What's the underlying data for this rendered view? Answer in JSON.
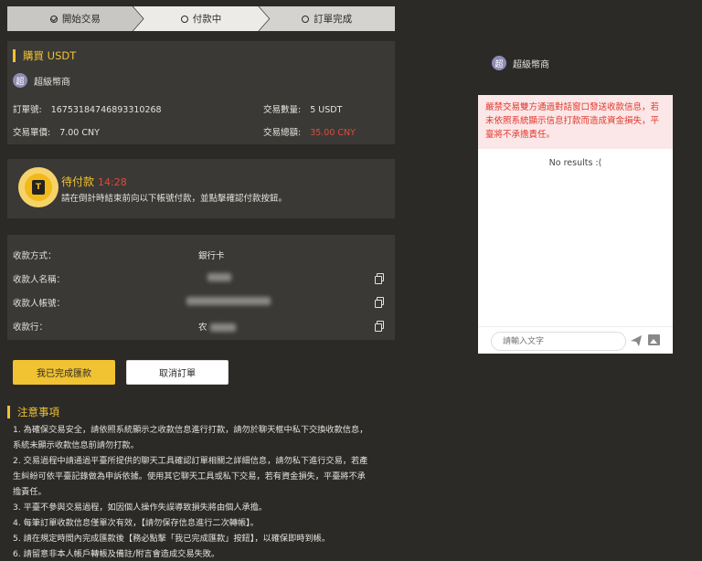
{
  "steps": [
    "開始交易",
    "付款中",
    "訂單完成"
  ],
  "order": {
    "title": "購買 USDT",
    "merchant_avatar": "超",
    "merchant_name": "超級幣商",
    "order_no_label": "訂單號:",
    "order_no": "1675318474689331026​8",
    "qty_label": "交易數量:",
    "qty": "5 USDT",
    "price_label": "交易單價:",
    "price": "7.00 CNY",
    "total_label": "交易總額:",
    "total": "35.00 CNY"
  },
  "pending": {
    "title": "待付款",
    "timer": "14:28",
    "desc": "請在倒計時結束前向以下帳號付款，並點擊確認付款按鈕。"
  },
  "payment": {
    "rows": [
      {
        "label": "收款方式：",
        "value": "銀行卡"
      },
      {
        "label": "收款人名稱：",
        "value": ""
      },
      {
        "label": "收款人帳號：",
        "value": ""
      },
      {
        "label": "收款行：",
        "value": "农"
      }
    ]
  },
  "buttons": {
    "done": "我已完成匯款",
    "cancel": "取消訂單"
  },
  "notes": {
    "title": "注意事項",
    "items": [
      "1. 為確保交易安全，請依照系統顯示之收款信息進行打款，請勿於聊天框中私下交換收款信息，",
      "系統未顯示收款信息前請勿打款。",
      "2. 交易過程中請通過平臺所提供的聊天工具確認訂單相關之詳細信息，請勿私下進行交易，若產",
      "生糾紛可依平臺記錄做為申訴依據。使用其它聊天工具或私下交易，若有資金損失，平臺將不承",
      "擔責任。",
      "3. 平臺不參與交易過程，如因個人操作失誤導致損失將由個人承擔。",
      "4. 每筆訂單收款信息僅單次有效，【請勿保存信息進行二次轉帳】。",
      "5. 請在規定時間內完成匯款後【務必點擊「我已完成匯款」按鈕】，以確保即時到帳。",
      "6. 請留意非本人帳戶轉帳及備註/附言會造成交易失敗。"
    ]
  },
  "chat": {
    "merchant_avatar": "超",
    "merchant_name": "超級幣商",
    "warning": "嚴禁交易雙方通過對話窗口發送收款信息，若未依照系統顯示信息打款而造成資金損失，平臺將不承擔責任。",
    "empty": "No results :(",
    "placeholder": "請輸入文字"
  }
}
